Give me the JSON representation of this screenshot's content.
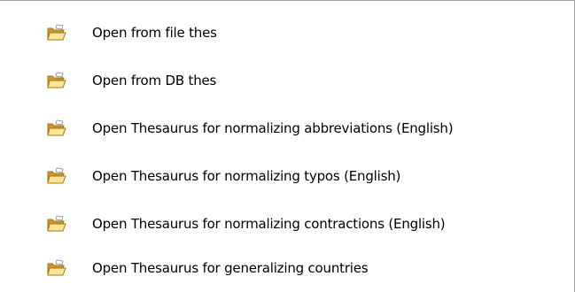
{
  "menu": {
    "items": [
      {
        "label": "Open from file thes",
        "icon": "open-folder-icon"
      },
      {
        "label": "Open from DB thes",
        "icon": "open-folder-icon"
      },
      {
        "label": "Open Thesaurus for normalizing abbreviations (English)",
        "icon": "open-folder-icon"
      },
      {
        "label": "Open Thesaurus for normalizing typos (English)",
        "icon": "open-folder-icon"
      },
      {
        "label": "Open Thesaurus for normalizing contractions (English)",
        "icon": "open-folder-icon"
      },
      {
        "label": "Open Thesaurus for generalizing countries",
        "icon": "open-folder-icon"
      }
    ]
  },
  "colors": {
    "folder_body": "#f5cf5a",
    "folder_shadow": "#c9962a",
    "folder_outline": "#a67516",
    "folder_front": "#fbe59a",
    "border": "#a0a0a0"
  }
}
